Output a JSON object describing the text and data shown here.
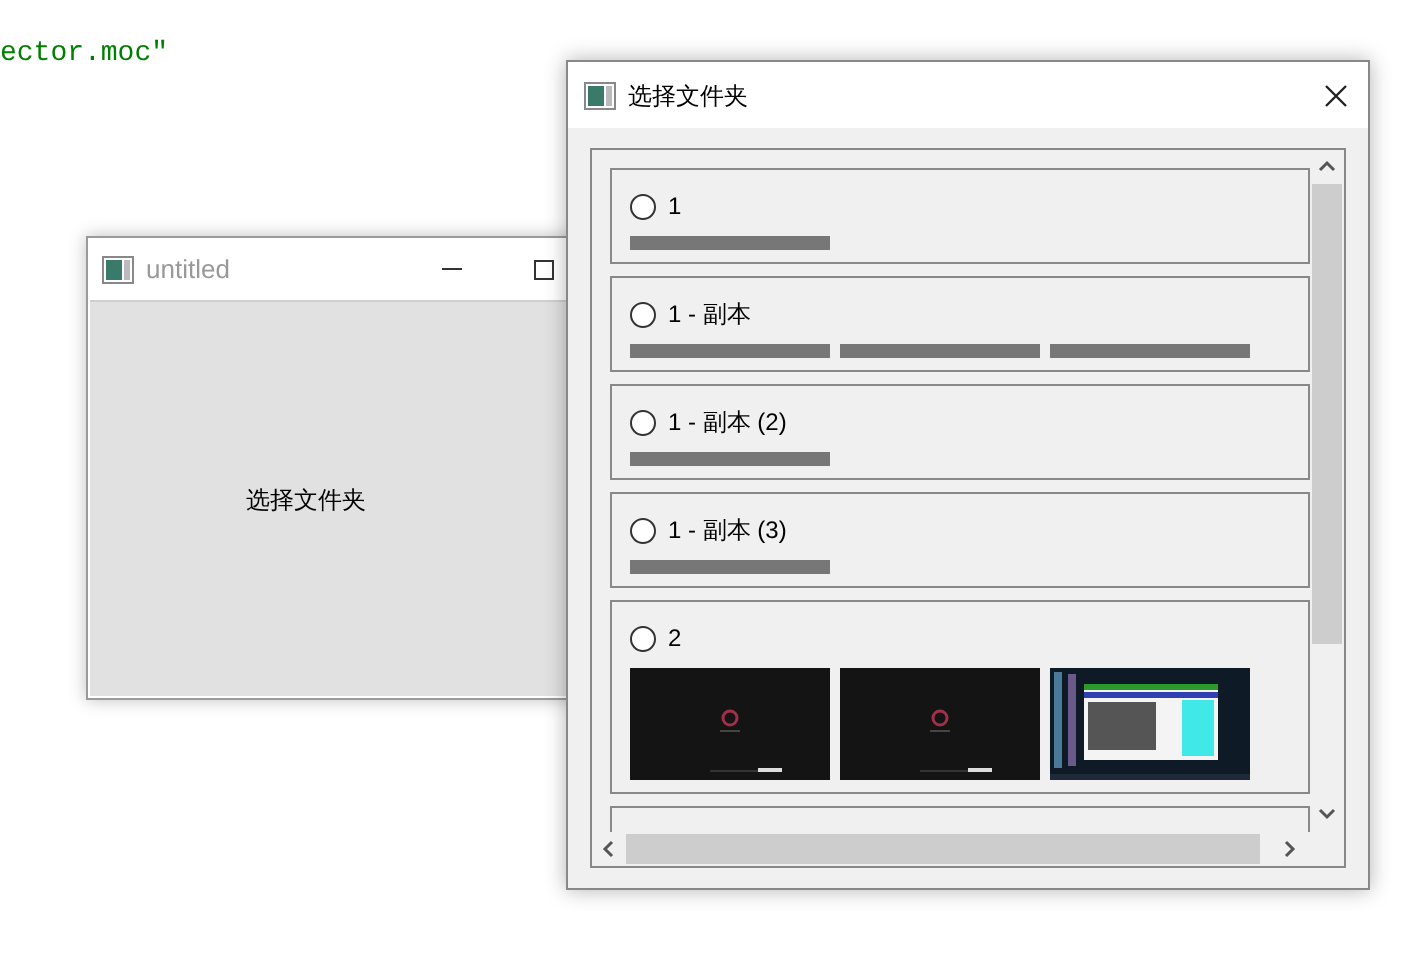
{
  "background_code": "ector.moc\"",
  "main_window": {
    "title": "untitled",
    "button": "选择文件夹"
  },
  "dialog": {
    "title": "选择文件夹",
    "folders": [
      {
        "label": "1",
        "selected": false,
        "thumbnails": [
          {
            "kind": "bar"
          }
        ]
      },
      {
        "label": "1 - 副本",
        "selected": false,
        "thumbnails": [
          {
            "kind": "bar"
          },
          {
            "kind": "bar"
          },
          {
            "kind": "bar"
          }
        ]
      },
      {
        "label": "1 - 副本 (2)",
        "selected": false,
        "thumbnails": [
          {
            "kind": "bar"
          }
        ]
      },
      {
        "label": "1 - 副本 (3)",
        "selected": false,
        "thumbnails": [
          {
            "kind": "bar"
          }
        ]
      },
      {
        "label": "2",
        "selected": false
      },
      {
        "kind": "partial"
      }
    ]
  }
}
